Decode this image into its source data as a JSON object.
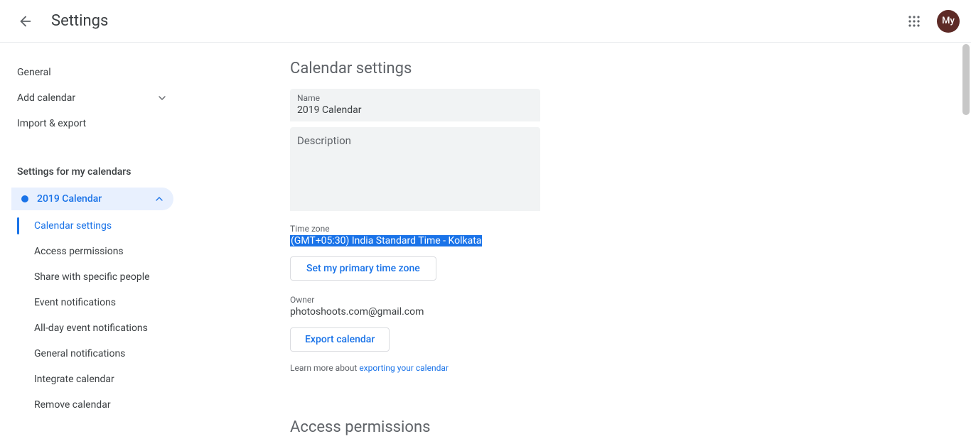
{
  "header": {
    "title": "Settings",
    "avatar_initials": "My"
  },
  "sidebar": {
    "general": "General",
    "add_calendar": "Add calendar",
    "import_export": "Import & export",
    "group_title": "Settings for my calendars",
    "calendar_name": "2019 Calendar",
    "subitems": {
      "calendar_settings": "Calendar settings",
      "access_permissions": "Access permissions",
      "share_specific": "Share with specific people",
      "event_notifications": "Event notifications",
      "all_day_notifications": "All-day event notifications",
      "general_notifications": "General notifications",
      "integrate_calendar": "Integrate calendar",
      "remove_calendar": "Remove calendar"
    }
  },
  "main": {
    "section_title": "Calendar settings",
    "name_label": "Name",
    "name_value": "2019 Calendar",
    "description_label": "Description",
    "timezone_label": "Time zone",
    "timezone_value": "(GMT+05:30) India Standard Time - Kolkata",
    "set_primary_tz_btn": "Set my primary time zone",
    "owner_label": "Owner",
    "owner_value": "photoshoots.com@gmail.com",
    "export_btn": "Export calendar",
    "learn_prefix": "Learn more about ",
    "learn_link": "exporting your calendar",
    "access_permissions_title": "Access permissions"
  }
}
